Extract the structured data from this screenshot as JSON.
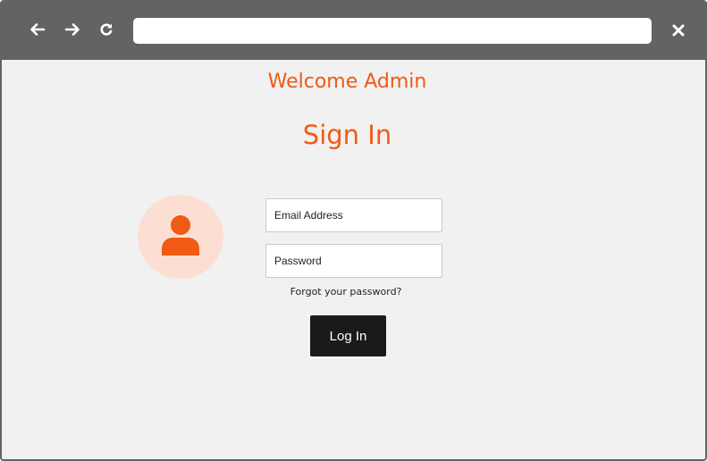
{
  "window": {
    "address_value": ""
  },
  "icons": {
    "back": "arrow-left-icon",
    "forward": "arrow-right-icon",
    "reload": "reload-icon",
    "close": "close-icon",
    "avatar": "user-icon"
  },
  "colors": {
    "accent": "#f05a14",
    "avatar_bg": "#fcdfd2",
    "toolbar": "#636363",
    "page_bg": "#f1f1f1",
    "button_bg": "#1a1a1a"
  },
  "header": {
    "welcome": "Welcome Admin",
    "title": "Sign In"
  },
  "form": {
    "email_placeholder": "Email Address",
    "email_value": "",
    "password_placeholder": "Password",
    "password_value": "",
    "forgot_label": "Forgot your password?",
    "submit_label": "Log In"
  }
}
